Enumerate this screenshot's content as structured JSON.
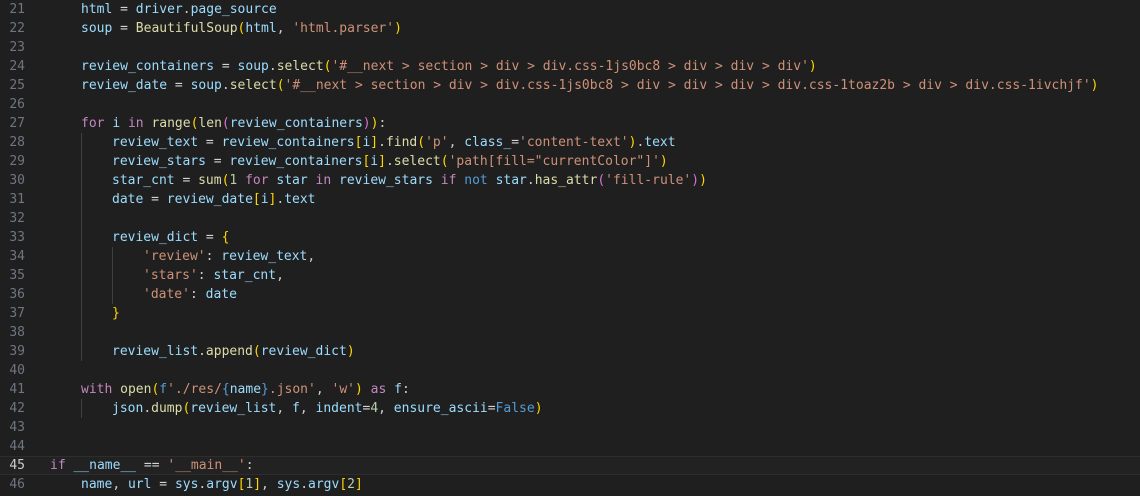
{
  "editor": {
    "current_line": 45,
    "lines": [
      {
        "num": "21",
        "indent": 1,
        "tokens": [
          [
            "v",
            "html"
          ],
          [
            "o",
            " = "
          ],
          [
            "v",
            "driver"
          ],
          [
            "p",
            "."
          ],
          [
            "v",
            "page_source"
          ]
        ]
      },
      {
        "num": "22",
        "indent": 1,
        "tokens": [
          [
            "v",
            "soup"
          ],
          [
            "o",
            " = "
          ],
          [
            "f",
            "BeautifulSoup"
          ],
          [
            "b1",
            "("
          ],
          [
            "v",
            "html"
          ],
          [
            "p",
            ", "
          ],
          [
            "s",
            "'html.parser'"
          ],
          [
            "b1",
            ")"
          ]
        ]
      },
      {
        "num": "23",
        "indent": 1,
        "tokens": []
      },
      {
        "num": "24",
        "indent": 1,
        "tokens": [
          [
            "v",
            "review_containers"
          ],
          [
            "o",
            " = "
          ],
          [
            "v",
            "soup"
          ],
          [
            "p",
            "."
          ],
          [
            "f",
            "select"
          ],
          [
            "b1",
            "("
          ],
          [
            "s",
            "'#__next > section > div > div.css-1js0bc8 > div > div > div'"
          ],
          [
            "b1",
            ")"
          ]
        ]
      },
      {
        "num": "25",
        "indent": 1,
        "tokens": [
          [
            "v",
            "review_date"
          ],
          [
            "o",
            " = "
          ],
          [
            "v",
            "soup"
          ],
          [
            "p",
            "."
          ],
          [
            "f",
            "select"
          ],
          [
            "b1",
            "("
          ],
          [
            "s",
            "'#__next > section > div > div.css-1js0bc8 > div > div > div > div.css-1toaz2b > div > div.css-1ivchjf'"
          ],
          [
            "b1",
            ")"
          ]
        ]
      },
      {
        "num": "26",
        "indent": 1,
        "tokens": []
      },
      {
        "num": "27",
        "indent": 1,
        "tokens": [
          [
            "k",
            "for"
          ],
          [
            "p",
            " "
          ],
          [
            "v",
            "i"
          ],
          [
            "p",
            " "
          ],
          [
            "k",
            "in"
          ],
          [
            "p",
            " "
          ],
          [
            "f",
            "range"
          ],
          [
            "b1",
            "("
          ],
          [
            "f",
            "len"
          ],
          [
            "b2",
            "("
          ],
          [
            "v",
            "review_containers"
          ],
          [
            "b2",
            ")"
          ],
          [
            "b1",
            ")"
          ],
          [
            "p",
            ":"
          ]
        ]
      },
      {
        "num": "28",
        "indent": 2,
        "tokens": [
          [
            "v",
            "review_text"
          ],
          [
            "o",
            " = "
          ],
          [
            "v",
            "review_containers"
          ],
          [
            "b1",
            "["
          ],
          [
            "v",
            "i"
          ],
          [
            "b1",
            "]"
          ],
          [
            "p",
            "."
          ],
          [
            "f",
            "find"
          ],
          [
            "b1",
            "("
          ],
          [
            "s",
            "'p'"
          ],
          [
            "p",
            ", "
          ],
          [
            "v",
            "class_"
          ],
          [
            "o",
            "="
          ],
          [
            "s",
            "'content-text'"
          ],
          [
            "b1",
            ")"
          ],
          [
            "p",
            "."
          ],
          [
            "v",
            "text"
          ]
        ]
      },
      {
        "num": "29",
        "indent": 2,
        "tokens": [
          [
            "v",
            "review_stars"
          ],
          [
            "o",
            " = "
          ],
          [
            "v",
            "review_containers"
          ],
          [
            "b1",
            "["
          ],
          [
            "v",
            "i"
          ],
          [
            "b1",
            "]"
          ],
          [
            "p",
            "."
          ],
          [
            "f",
            "select"
          ],
          [
            "b1",
            "("
          ],
          [
            "s",
            "'path[fill=\"currentColor\"]'"
          ],
          [
            "b1",
            ")"
          ]
        ]
      },
      {
        "num": "30",
        "indent": 2,
        "tokens": [
          [
            "v",
            "star_cnt"
          ],
          [
            "o",
            " = "
          ],
          [
            "f",
            "sum"
          ],
          [
            "b1",
            "("
          ],
          [
            "n",
            "1"
          ],
          [
            "p",
            " "
          ],
          [
            "k",
            "for"
          ],
          [
            "p",
            " "
          ],
          [
            "v",
            "star"
          ],
          [
            "p",
            " "
          ],
          [
            "k",
            "in"
          ],
          [
            "p",
            " "
          ],
          [
            "v",
            "review_stars"
          ],
          [
            "p",
            " "
          ],
          [
            "k",
            "if"
          ],
          [
            "p",
            " "
          ],
          [
            "kb",
            "not"
          ],
          [
            "p",
            " "
          ],
          [
            "v",
            "star"
          ],
          [
            "p",
            "."
          ],
          [
            "f",
            "has_attr"
          ],
          [
            "b2",
            "("
          ],
          [
            "s",
            "'fill-rule'"
          ],
          [
            "b2",
            ")"
          ],
          [
            "b1",
            ")"
          ]
        ]
      },
      {
        "num": "31",
        "indent": 2,
        "tokens": [
          [
            "v",
            "date"
          ],
          [
            "o",
            " = "
          ],
          [
            "v",
            "review_date"
          ],
          [
            "b1",
            "["
          ],
          [
            "v",
            "i"
          ],
          [
            "b1",
            "]"
          ],
          [
            "p",
            "."
          ],
          [
            "v",
            "text"
          ]
        ]
      },
      {
        "num": "32",
        "indent": 2,
        "tokens": []
      },
      {
        "num": "33",
        "indent": 2,
        "tokens": [
          [
            "v",
            "review_dict"
          ],
          [
            "o",
            " = "
          ],
          [
            "b1",
            "{"
          ]
        ]
      },
      {
        "num": "34",
        "indent": 3,
        "tokens": [
          [
            "s",
            "'review'"
          ],
          [
            "p",
            ": "
          ],
          [
            "v",
            "review_text"
          ],
          [
            "p",
            ","
          ]
        ]
      },
      {
        "num": "35",
        "indent": 3,
        "tokens": [
          [
            "s",
            "'stars'"
          ],
          [
            "p",
            ": "
          ],
          [
            "v",
            "star_cnt"
          ],
          [
            "p",
            ","
          ]
        ]
      },
      {
        "num": "36",
        "indent": 3,
        "tokens": [
          [
            "s",
            "'date'"
          ],
          [
            "p",
            ": "
          ],
          [
            "v",
            "date"
          ]
        ]
      },
      {
        "num": "37",
        "indent": 2,
        "tokens": [
          [
            "b1",
            "}"
          ]
        ]
      },
      {
        "num": "38",
        "indent": 2,
        "tokens": []
      },
      {
        "num": "39",
        "indent": 2,
        "tokens": [
          [
            "v",
            "review_list"
          ],
          [
            "p",
            "."
          ],
          [
            "f",
            "append"
          ],
          [
            "b1",
            "("
          ],
          [
            "v",
            "review_dict"
          ],
          [
            "b1",
            ")"
          ]
        ]
      },
      {
        "num": "40",
        "indent": 1,
        "tokens": []
      },
      {
        "num": "41",
        "indent": 1,
        "tokens": [
          [
            "k",
            "with"
          ],
          [
            "p",
            " "
          ],
          [
            "f",
            "open"
          ],
          [
            "b1",
            "("
          ],
          [
            "kb",
            "f"
          ],
          [
            "s",
            "'./res/"
          ],
          [
            "kb",
            "{"
          ],
          [
            "v",
            "name"
          ],
          [
            "kb",
            "}"
          ],
          [
            "s",
            ".json'"
          ],
          [
            "p",
            ", "
          ],
          [
            "s",
            "'w'"
          ],
          [
            "b1",
            ")"
          ],
          [
            "p",
            " "
          ],
          [
            "k",
            "as"
          ],
          [
            "p",
            " "
          ],
          [
            "v",
            "f"
          ],
          [
            "p",
            ":"
          ]
        ]
      },
      {
        "num": "42",
        "indent": 2,
        "tokens": [
          [
            "v",
            "json"
          ],
          [
            "p",
            "."
          ],
          [
            "f",
            "dump"
          ],
          [
            "b1",
            "("
          ],
          [
            "v",
            "review_list"
          ],
          [
            "p",
            ", "
          ],
          [
            "v",
            "f"
          ],
          [
            "p",
            ", "
          ],
          [
            "v",
            "indent"
          ],
          [
            "o",
            "="
          ],
          [
            "n",
            "4"
          ],
          [
            "p",
            ", "
          ],
          [
            "v",
            "ensure_ascii"
          ],
          [
            "o",
            "="
          ],
          [
            "kb",
            "False"
          ],
          [
            "b1",
            ")"
          ]
        ]
      },
      {
        "num": "43",
        "indent": 1,
        "tokens": []
      },
      {
        "num": "44",
        "indent": 0,
        "tokens": []
      },
      {
        "num": "45",
        "indent": 0,
        "tokens": [
          [
            "k",
            "if"
          ],
          [
            "p",
            " "
          ],
          [
            "v",
            "__name__"
          ],
          [
            "o",
            " == "
          ],
          [
            "s",
            "'__main__'"
          ],
          [
            "p",
            ":"
          ]
        ]
      },
      {
        "num": "46",
        "indent": 1,
        "tokens": [
          [
            "v",
            "name"
          ],
          [
            "p",
            ", "
          ],
          [
            "v",
            "url"
          ],
          [
            "o",
            " = "
          ],
          [
            "v",
            "sys"
          ],
          [
            "p",
            "."
          ],
          [
            "v",
            "argv"
          ],
          [
            "b1",
            "["
          ],
          [
            "n",
            "1"
          ],
          [
            "b1",
            "]"
          ],
          [
            "p",
            ", "
          ],
          [
            "v",
            "sys"
          ],
          [
            "p",
            "."
          ],
          [
            "v",
            "argv"
          ],
          [
            "b1",
            "["
          ],
          [
            "n",
            "2"
          ],
          [
            "b1",
            "]"
          ]
        ]
      }
    ]
  }
}
